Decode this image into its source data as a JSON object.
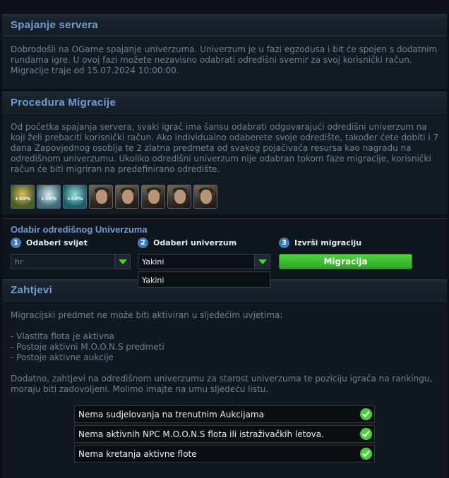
{
  "server_merge": {
    "title": "Spajanje servera",
    "text": "Dobrodošli na OGame spajanje univerzuma. Univerzum je u fazi egzodusa i bit će spojen s dodatnim rundama igre. U ovoj fazi možete nezavisno odabrati odredišni svemir za svoj korisnički račun. Migracije traje od 15.07.2024 10:00:00."
  },
  "procedure": {
    "title": "Procedura Migracije",
    "text": "Od početka spajanja servera, svaki igrač ima šansu odabrati odgovarajući odredišni univerzum na koji želi prebaciti korisnički račun. Ako individualno odaberete svoje odredište, također ćete dobiti i 7 dana Zapovjednog osoblja te 2 zlatna predmeta od svakog pojačivača resursa kao nagradu na odredišnom univerzumu. Ukoliko odredišni univerzum nije odabran tokom faze migracije, korisnički račun će biti migriran na predefinirano odredište.",
    "items": [
      {
        "icon": "metal-booster-icon",
        "label": "+30%"
      },
      {
        "icon": "crystal-booster-icon",
        "label": "+30%"
      },
      {
        "icon": "deuterium-booster-icon",
        "label": "+30%"
      },
      {
        "icon": "commander-portrait-icon",
        "label": ""
      },
      {
        "icon": "admiral-portrait-icon",
        "label": ""
      },
      {
        "icon": "engineer-portrait-icon",
        "label": ""
      },
      {
        "icon": "geologist-portrait-icon",
        "label": ""
      },
      {
        "icon": "technocrat-portrait-icon",
        "label": ""
      }
    ]
  },
  "migration": {
    "title": "Odabir odredišnog Univerzuma",
    "step1": {
      "num": "1",
      "label": "Odaberi svijet",
      "value": "hr"
    },
    "step2": {
      "num": "2",
      "label": "Odaberi univerzum",
      "value": "Yakini",
      "option": "Yakini"
    },
    "step3": {
      "num": "3",
      "label": "Izvrši migraciju",
      "button": "Migracija"
    },
    "colors": {
      "accent": "#49d23b",
      "step_badge": "#3a7cc4"
    }
  },
  "requirements": {
    "title": "Zahtjevi",
    "intro": "Migracijski predmet ne može biti aktiviran u sljedećim uvjetima:",
    "conditions": [
      "- Vlastita flota je aktivna",
      "- Postoje aktivni M.O.O.N.S predmeti",
      "- Postoje aktivne aukcije"
    ],
    "extra": "Dodatno, zahtjevi na odredišnom univerzumu za starost univerzuma te poziciju igrača na rankingu, moraju biti zadovoljeni. Molimo imajte na umu sljedeću listu.",
    "checks": [
      "Nema sudjelovanja na trenutnim Aukcijama",
      "Nema aktivnih NPC M.O.O.N.S flota ili istraživačkih letova.",
      "Nema kretanja aktivne flote"
    ]
  }
}
